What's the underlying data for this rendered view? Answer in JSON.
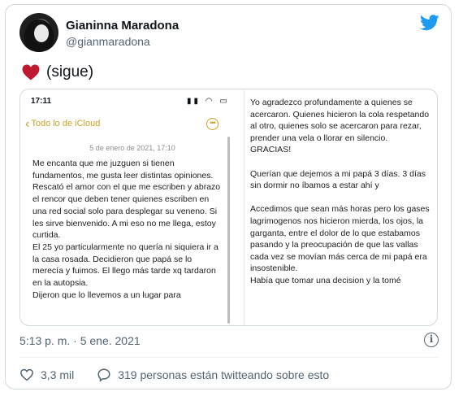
{
  "user": {
    "name": "Gianinna Maradona",
    "handle": "@gianmaradona"
  },
  "tweet": {
    "text": "(sigue)",
    "emoji": "heart",
    "timestamp": "5:13 p. m. · 5 ene. 2021"
  },
  "media": {
    "status_time": "17:11",
    "status_icons": "▮▮ ◠ ▭",
    "back_label": "Todo lo de iCloud",
    "more_glyph": "•••",
    "note_date": "5 de enero de 2021, 17:10",
    "note_left": "Me encanta que me juzguen si tienen fundamentos, me gusta leer distintas opiniones. Rescató el amor con el que me escriben y abrazo el rencor que deben tener quienes escriben en una red social solo para desplegar su veneno. Si les sirve bienvenido. A mi eso no me llega, estoy curtida.\nEl 25 yo particularmente no quería ni siquiera ir a la casa rosada. Decidieron que papá se lo merecía y fuimos. El llego más tarde xq tardaron en la autopsia.\nDijeron que lo llevemos a un lugar para",
    "note_right": "Yo agradezco profundamente a quienes se acercaron. Quienes hicieron la cola respetando al otro, quienes solo se acercaron para rezar, prender una vela o llorar en silencio. GRACIAS!\n\nQuerían que dejemos a mi papá 3 días. 3 días sin dormir no íbamos a estar ahí y\n\nAccedimos que sean más horas pero los gases lagrimogenos nos hicieron mierda, los ojos, la garganta, entre el dolor de lo que estabamos pasando y la preocupación de que las vallas cada vez se movían más cerca de mi papá era insostenible.\nHabía que tomar una decision y la tomé"
  },
  "actions": {
    "likes": "3,3 mil",
    "replies_text": "319 personas están twitteando sobre esto"
  },
  "colors": {
    "twitter_blue": "#1d9bf0",
    "heart_red": "#be1931",
    "notes_accent": "#c9a227",
    "secondary_text": "#536471"
  }
}
